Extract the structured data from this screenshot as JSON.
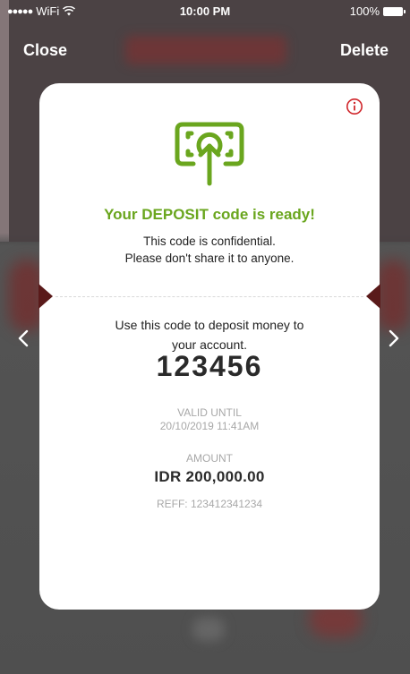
{
  "status_bar": {
    "signal": "●●●●●",
    "carrier": "WiFi",
    "time": "10:00 PM",
    "battery": "100%"
  },
  "nav": {
    "close_label": "Close",
    "delete_label": "Delete"
  },
  "card": {
    "title": "Your DEPOSIT code is ready!",
    "confidential_line1": "This code is confidential.",
    "confidential_line2": "Please don't share it to anyone.",
    "instruction_line1": "Use this code to deposit money to",
    "instruction_line2": "your account.",
    "code": "123456",
    "valid_until_label": "VALID UNTIL",
    "valid_until_value": "20/10/2019 11:41AM",
    "amount_label": "AMOUNT",
    "amount_value": "IDR 200,000.00",
    "reff": "REFF: 123412341234"
  },
  "colors": {
    "accent_green": "#6aa61e",
    "info_red": "#d0262b",
    "background": "#4f4f4f"
  },
  "icons": {
    "info": "info-icon",
    "deposit": "deposit-money-icon",
    "prev": "chevron-left-icon",
    "next": "chevron-right-icon"
  }
}
